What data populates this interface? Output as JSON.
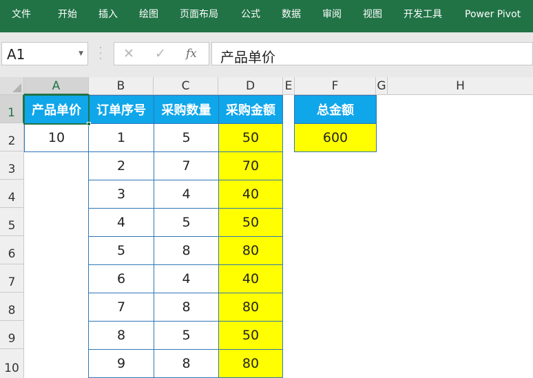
{
  "ribbon": {
    "tabs": [
      "文件",
      "开始",
      "插入",
      "绘图",
      "页面布局",
      "公式",
      "数据",
      "审阅",
      "视图",
      "开发工具",
      "Power Pivot"
    ]
  },
  "formula_bar": {
    "name_box": "A1",
    "cancel_glyph": "✕",
    "enter_glyph": "✓",
    "fx_label": "fx",
    "content": "产品单价"
  },
  "sheet": {
    "column_headers": [
      "A",
      "B",
      "C",
      "D",
      "E",
      "F",
      "G",
      "H"
    ],
    "row_headers": [
      "1",
      "2",
      "3",
      "4",
      "5",
      "6",
      "7",
      "8",
      "9",
      "10"
    ],
    "active_cell": "A1",
    "unit_price": {
      "header": "产品单价",
      "value": "10"
    },
    "orders_table": {
      "headers": [
        "订单序号",
        "采购数量",
        "采购金额"
      ],
      "rows": [
        [
          "1",
          "5",
          "50"
        ],
        [
          "2",
          "7",
          "70"
        ],
        [
          "3",
          "4",
          "40"
        ],
        [
          "4",
          "5",
          "50"
        ],
        [
          "5",
          "8",
          "80"
        ],
        [
          "6",
          "4",
          "40"
        ],
        [
          "7",
          "8",
          "80"
        ],
        [
          "8",
          "5",
          "50"
        ],
        [
          "9",
          "8",
          "80"
        ]
      ]
    },
    "total": {
      "header": "总金额",
      "value": "600"
    }
  },
  "colors": {
    "ribbon": "#217346",
    "header_fill": "#0fa6ea",
    "highlight_fill": "#ffff00",
    "table_border": "#2e75b6"
  }
}
